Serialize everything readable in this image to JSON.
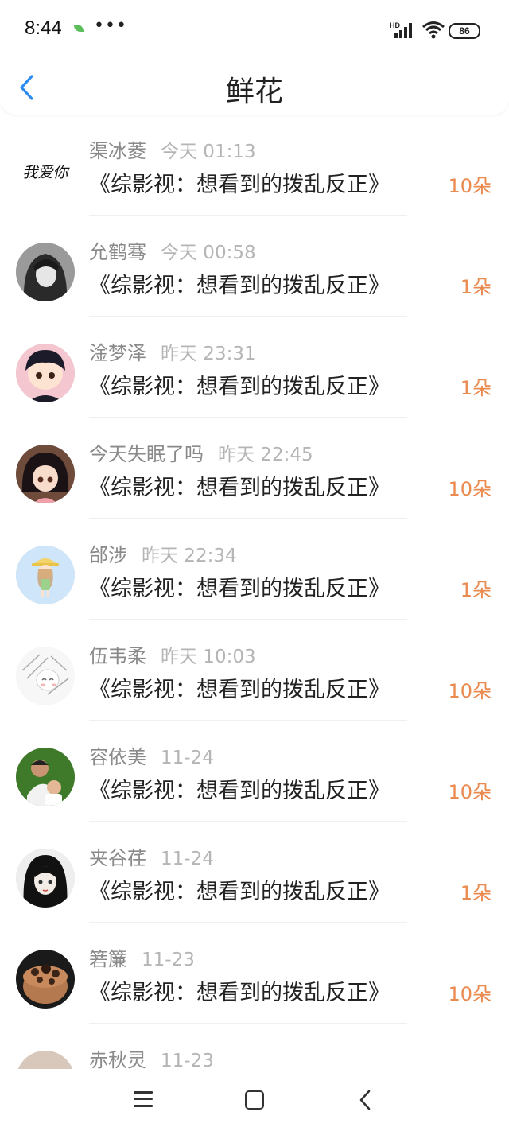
{
  "status_bar": {
    "time": "8:44",
    "dots": "•••",
    "battery": "86",
    "hd_label": "HD"
  },
  "header": {
    "title": "鲜花"
  },
  "colors": {
    "accent": "#2d8cf0",
    "count": "#ea8a4f"
  },
  "rows": [
    {
      "name": "渠冰菱",
      "time": "今天 01:13",
      "work": "《综影视：想看到的拨乱反正》",
      "count": "10朵",
      "avatar_text": "我爱你"
    },
    {
      "name": "允鹤骞",
      "time": "今天 00:58",
      "work": "《综影视：想看到的拨乱反正》",
      "count": "1朵"
    },
    {
      "name": "淦梦泽",
      "time": "昨天 23:31",
      "work": "《综影视：想看到的拨乱反正》",
      "count": "1朵"
    },
    {
      "name": "今天失眠了吗",
      "time": "昨天 22:45",
      "work": "《综影视：想看到的拨乱反正》",
      "count": "10朵"
    },
    {
      "name": "邰涉",
      "time": "昨天 22:34",
      "work": "《综影视：想看到的拨乱反正》",
      "count": "1朵"
    },
    {
      "name": "伍韦柔",
      "time": "昨天 10:03",
      "work": "《综影视：想看到的拨乱反正》",
      "count": "10朵"
    },
    {
      "name": "容依美",
      "time": "11-24",
      "work": "《综影视：想看到的拨乱反正》",
      "count": "10朵"
    },
    {
      "name": "夹谷荏",
      "time": "11-24",
      "work": "《综影视：想看到的拨乱反正》",
      "count": "1朵"
    },
    {
      "name": "箬簾",
      "time": "11-23",
      "work": "《综影视：想看到的拨乱反正》",
      "count": "10朵"
    },
    {
      "name": "赤秋灵",
      "time": "11-23",
      "work": "",
      "count": ""
    }
  ]
}
